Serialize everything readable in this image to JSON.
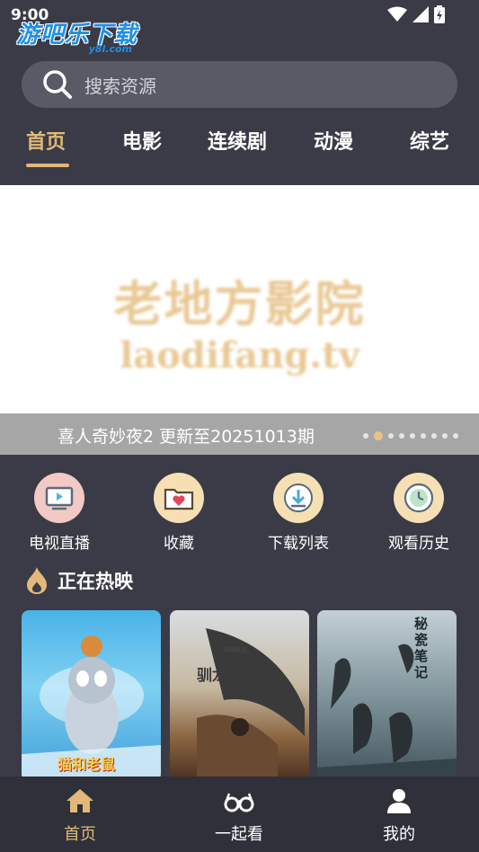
{
  "status_bar": {
    "time": "9:00"
  },
  "watermark": {
    "main": "游吧乐下载",
    "sub": "y8l.com"
  },
  "search": {
    "placeholder": "搜索资源"
  },
  "tabs": [
    {
      "label": "首页",
      "active": true
    },
    {
      "label": "电影",
      "active": false
    },
    {
      "label": "连续剧",
      "active": false
    },
    {
      "label": "动漫",
      "active": false
    },
    {
      "label": "综艺",
      "active": false
    }
  ],
  "banner": {
    "logo_cn": "老地方影院",
    "logo_en": "laodifang.tv",
    "caption": "喜人奇妙夜2 更新至20251013期",
    "dot_count": 9,
    "active_dot": 1
  },
  "quick_links": [
    {
      "label": "电视直播",
      "icon": "tv-icon"
    },
    {
      "label": "收藏",
      "icon": "favorites-folder-icon"
    },
    {
      "label": "下载列表",
      "icon": "download-icon"
    },
    {
      "label": "观看历史",
      "icon": "history-clock-icon"
    }
  ],
  "hot_section": {
    "title": "正在热映"
  },
  "posters": [
    {
      "title_text": "猫和老鼠"
    },
    {
      "title_text": "驯龙高手",
      "badge": "IMAX"
    },
    {
      "title_text": "秘瓷笔记"
    }
  ],
  "bottom_nav": [
    {
      "label": "首页",
      "icon": "home-icon",
      "active": true
    },
    {
      "label": "一起看",
      "icon": "glasses-icon",
      "active": false
    },
    {
      "label": "我的",
      "icon": "profile-icon",
      "active": false
    }
  ],
  "colors": {
    "accent": "#e2b97a",
    "background": "#3a3b47",
    "nav_background": "#2f3039"
  }
}
